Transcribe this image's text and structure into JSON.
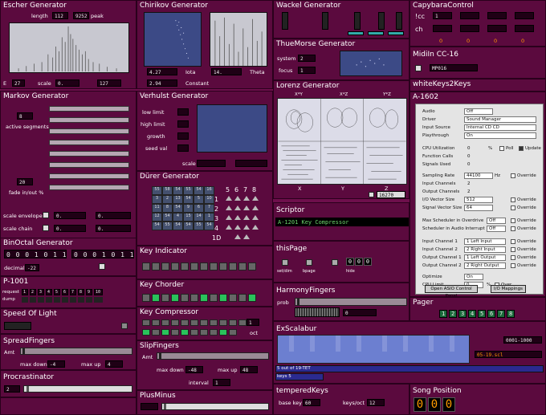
{
  "escher": {
    "title": "Escher Generator",
    "length_label": "length",
    "length": "112",
    "peak_val": "9252",
    "peak_label": "peak",
    "e_label": "E",
    "e_val": "27",
    "scale_label": "scale",
    "scale_val": "0.",
    "scale_val2": "127"
  },
  "chirikov": {
    "title": "Chirikov Generator",
    "iota_val": "4.27",
    "iota_label": "Iota",
    "theta_val": "14.",
    "theta_label": "Theta",
    "const_val": "2.94",
    "const_label": "Constant"
  },
  "wackel": {
    "title": "Wackel Generator"
  },
  "thue": {
    "title": "ThueMorse Generator",
    "system_label": "system",
    "system_val": "2",
    "focus_label": "focus",
    "focus_val": "1"
  },
  "capy": {
    "title": "CapybaraControl",
    "cc_label": "!cc",
    "ch_label": "ch",
    "cc_val": "1",
    "ch_vals": [
      "0",
      "0",
      "0",
      "0"
    ]
  },
  "midiin": {
    "title": "MidiIn CC-16",
    "value": "MP016"
  },
  "whitekeys": {
    "title": "whiteKeys2Keys"
  },
  "a1602": {
    "title": "A-1602"
  },
  "markov": {
    "title": "Markov Generator",
    "active_val": "8",
    "active_label": "active segments",
    "fade_val": "20",
    "fade_label": "fade in/out %",
    "env_label": "scale envelope",
    "env_val1": "0.",
    "env_val2": "0.",
    "chain_label": "scale chain",
    "chain_val1": "0.",
    "chain_val2": "0."
  },
  "verhulst": {
    "title": "Verhulst Generator",
    "low_label": "low limit",
    "high_label": "high limit",
    "growth_label": "growth",
    "seed_label": "seed val",
    "scale_label": "scale"
  },
  "lorenz": {
    "title": "Lorenz Generator",
    "tab_labels": [
      "X*Y",
      "X*Z",
      "Y*Z"
    ],
    "axis_labels": [
      "X",
      "Y",
      "Z"
    ],
    "val": "16270"
  },
  "durer": {
    "title": "Dürer Generator",
    "grid": [
      "55",
      "58",
      "54",
      "55",
      "54",
      "16",
      "3",
      "2",
      "13",
      "54",
      "5",
      "10",
      "11",
      "8",
      "54",
      "9",
      "6",
      "7",
      "12",
      "54",
      "4",
      "15",
      "14",
      "1",
      "54",
      "55",
      "54",
      "54",
      "55",
      "54"
    ],
    "dims": [
      "5",
      "6",
      "7",
      "8"
    ],
    "idx": [
      "1",
      "2",
      "3",
      "4"
    ],
    "side": "1D"
  },
  "scriptor": {
    "title": "Scriptor",
    "value": "A-1201   Key Compressor"
  },
  "thispage": {
    "title": "thisPage",
    "labels": [
      "set/dim",
      "bpage",
      "hide"
    ],
    "lcd": "0"
  },
  "binoctal": {
    "title": "BinOctal Generator",
    "bits1": "0 0 0 1 0 1 1 0",
    "bits2": "0 0 0 1 0 1 1 0",
    "decimal_label": "decimal",
    "decimal_val": "-22"
  },
  "keyindicator": {
    "title": "Key Indicator"
  },
  "harmony": {
    "title": "HarmonyFingers",
    "prob_label": "prob",
    "val": "0"
  },
  "p1001": {
    "title": "P-1001",
    "request_label": "request",
    "dump_label": "dump",
    "nums": [
      "1",
      "2",
      "3",
      "4",
      "5",
      "6",
      "7",
      "8",
      "9",
      "10"
    ]
  },
  "keychorder": {
    "title": "Key Chorder"
  },
  "pager": {
    "title": "Pager",
    "pages": [
      "1",
      "2",
      "3",
      "4",
      "5",
      "6",
      "7",
      "8"
    ]
  },
  "speedlight": {
    "title": "Speed Of Light"
  },
  "keycomp": {
    "title": "Key Compressor",
    "oct_val": "1",
    "oct_label": "oct"
  },
  "exscalabur": {
    "title": "ExScalabur",
    "range": "0001-1000",
    "file": "05-19.scl",
    "status": "5 out of 19-TET",
    "keys": "keys 5"
  },
  "spread": {
    "title": "SpreadFingers",
    "amt_label": "Amt",
    "down_label": "max down",
    "down_val": "-4",
    "up_label": "max up",
    "up_val": "4"
  },
  "slip": {
    "title": "SlipFingers",
    "amt_label": "Amt",
    "down_label": "max down",
    "down_val": "-48",
    "up_label": "max up",
    "up_val": "48",
    "interval_label": "interval",
    "interval_val": "1"
  },
  "procrast": {
    "title": "Procrastinator",
    "val": "2"
  },
  "plusminus": {
    "title": "PlusMinus"
  },
  "tempered": {
    "title": "temperedKeys",
    "base_label": "base key",
    "base_val": "60",
    "oct_label": "keys/oct",
    "oct_val": "12"
  },
  "songpos": {
    "title": "Song Position",
    "digits": [
      "0",
      "0",
      "0"
    ]
  },
  "asio": {
    "audio_label": "Audio",
    "audio_val": "Off",
    "driver_label": "Driver",
    "driver_val": "Sound Manager",
    "input_label": "Input Source",
    "input_val": "Internal CD CD",
    "thru_label": "Playthrough",
    "thru_val": "On",
    "cpu_label": "CPU Utilization",
    "cpu_val": "0",
    "pct": "%",
    "poll_label": "Poll",
    "update_label": "Update",
    "func_label": "Function Calls",
    "func_val": "0",
    "sig_label": "Signals Used",
    "sig_val": "0",
    "sr_label": "Sampling Rate",
    "sr_val": "44100",
    "hz": "Hz",
    "override": "Override",
    "inch_label": "Input Channels",
    "inch_val": "2",
    "outch_label": "Output Channels",
    "outch_val": "2",
    "io_label": "I/O Vector Size",
    "io_val": "512",
    "sv_label": "Signal Vector Size",
    "sv_val": "64",
    "maxsched_label": "Max Scheduler in Overdrive",
    "maxsched_val": "Off",
    "schedint_label": "Scheduler in Audio Interrupt",
    "schedint_val": "Off",
    "ic1_label": "Input Channel 1",
    "ic1_val": "1 Left Input",
    "ic2_label": "Input Channel 2",
    "ic2_val": "2 Right Input",
    "oc1_label": "Output Channel 1",
    "oc1_val": "1 Left Output",
    "oc2_label": "Output Channel 2",
    "oc2_val": "2 Right Output",
    "opt_label": "Optimize",
    "opt_val": "On",
    "cpulim_label": "CPU Limit",
    "cpulim_val": "0",
    "over_label": "Over",
    "asio_btn": "Open ASIO Control Panel",
    "io_btn": "I/O Mappings"
  }
}
